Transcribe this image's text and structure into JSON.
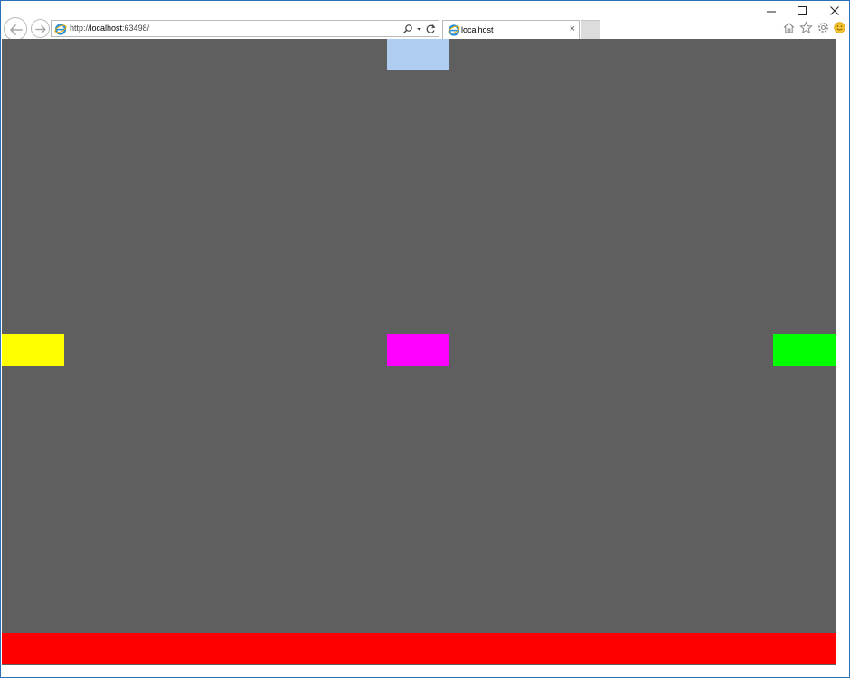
{
  "browser": {
    "url_prefix": "http://",
    "url_host": "localhost",
    "url_rest": ":63498/",
    "tab_title": "localhost",
    "tab_close": "×"
  },
  "icons": {
    "back": "back-arrow-icon",
    "forward": "forward-arrow-icon",
    "search": "search-icon",
    "refresh": "refresh-icon",
    "home": "home-icon",
    "favorites": "star-icon",
    "settings": "gear-icon",
    "feedback": "smiley-icon"
  },
  "page": {
    "background": "#5f5f5f",
    "blocks": [
      {
        "name": "top",
        "color": "#aecdf0"
      },
      {
        "name": "left",
        "color": "#ffff00"
      },
      {
        "name": "center",
        "color": "#ff00ff"
      },
      {
        "name": "right",
        "color": "#00ff00"
      },
      {
        "name": "bottom",
        "color": "#ff0000"
      }
    ]
  }
}
